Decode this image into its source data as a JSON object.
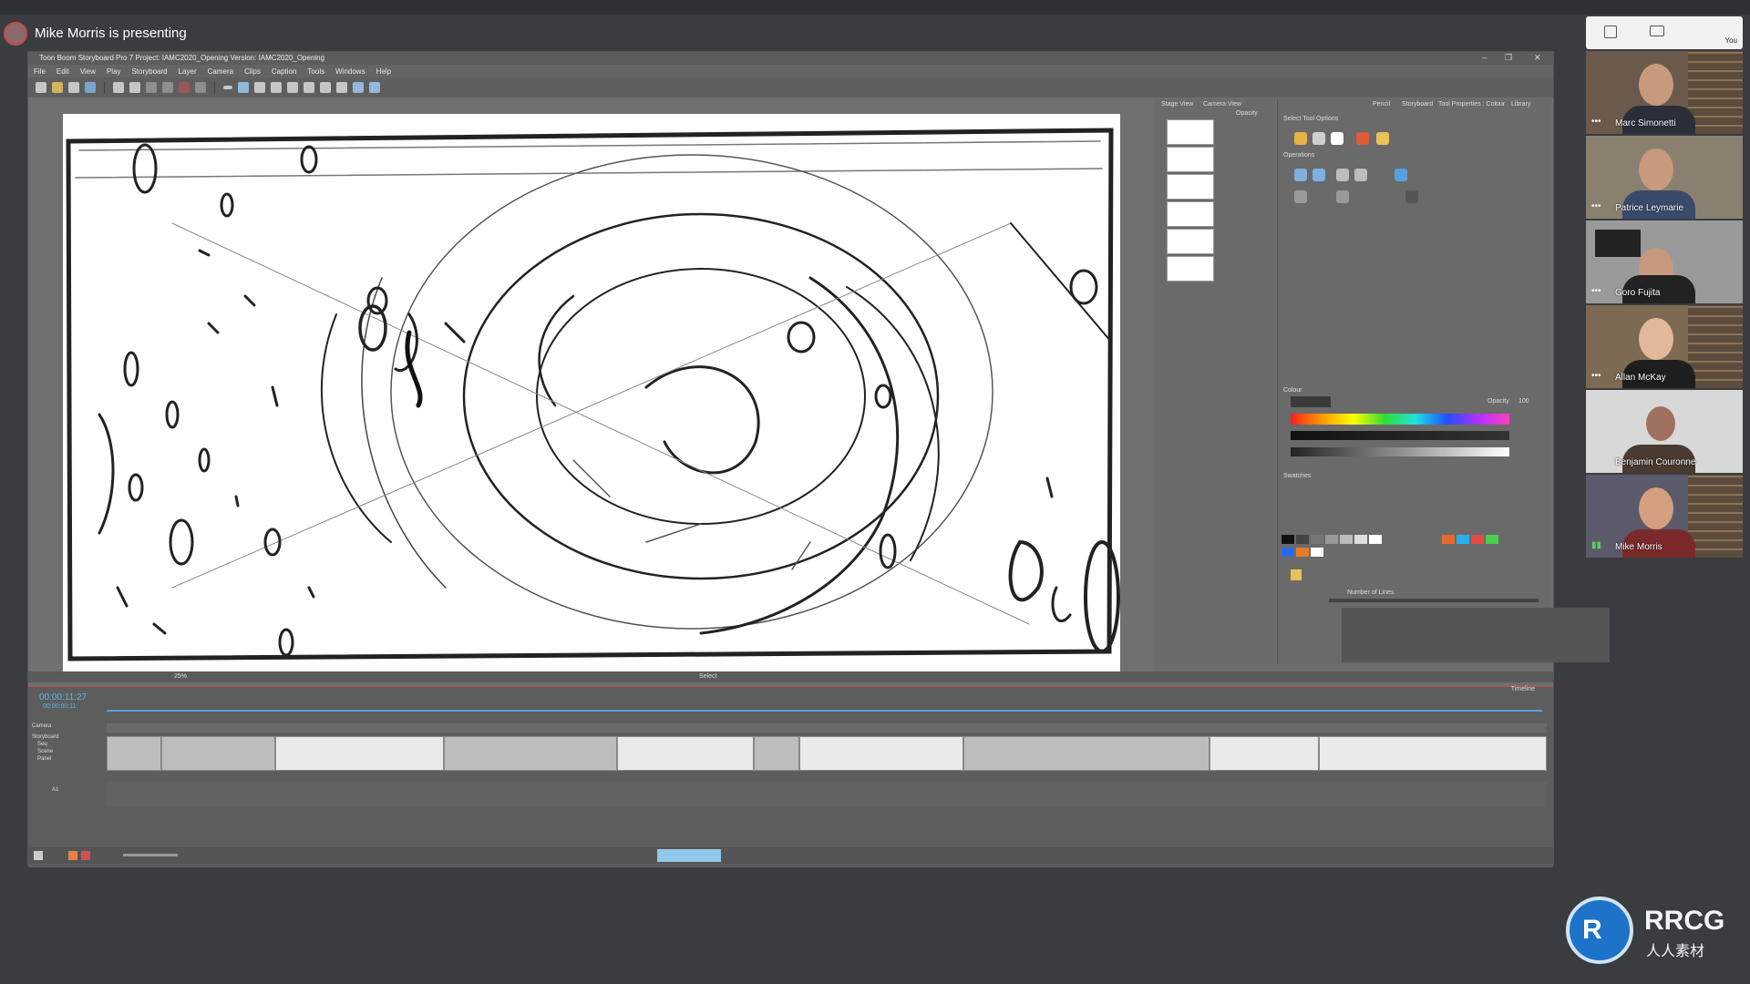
{
  "presentation": {
    "presenter_text": "Mike Morris is presenting"
  },
  "app": {
    "title": "Toon Boom Storyboard Pro 7 Project: IAMC2020_Opening Version: IAMC2020_Opening",
    "menu": [
      "File",
      "Edit",
      "View",
      "Play",
      "Storyboard",
      "Layer",
      "Camera",
      "Clips",
      "Caption",
      "Tools",
      "Windows",
      "Help"
    ],
    "panels": {
      "stage_tab": "Stage View",
      "camera_tab": "Camera View",
      "opacity_label": "Opacity",
      "right_tabs": [
        "Pencil",
        "Storyboard",
        "Tool Properties : Colour",
        "Library"
      ],
      "select_tool_options": "Select Tool Options",
      "operations": "Operations",
      "colour_title": "Colour",
      "colour_opacity_label": "Opacity",
      "colour_opacity_value": "100",
      "swatches_title": "Swatches",
      "number_of_lines": "Number of Lines",
      "select_label": "Select",
      "status_zoom": "25%"
    },
    "timeline": {
      "title": "Timeline",
      "timecode": "00:00:11:27",
      "subtimecode": "00:00:00:11",
      "track_camera": "Camera",
      "track_storyboard": "Storyboard",
      "track_seq": "Seq",
      "track_scene": "Scene",
      "track_panel": "Panel",
      "track_audio": "A1"
    }
  },
  "participants": {
    "self_label": "You",
    "list": [
      {
        "name": "Marc Simonetti"
      },
      {
        "name": "Patrice Leymarie"
      },
      {
        "name": "Goro Fujita"
      },
      {
        "name": "Allan McKay"
      },
      {
        "name": "Benjamin Couronne"
      },
      {
        "name": "Mike Morris"
      }
    ]
  },
  "logo": {
    "brand": "RRCG",
    "sub": "人人素材"
  },
  "colors": {
    "accent_blue": "#5aa0e0",
    "timecode_blue": "#5ab8e8",
    "record_red": "#c94a4a"
  }
}
